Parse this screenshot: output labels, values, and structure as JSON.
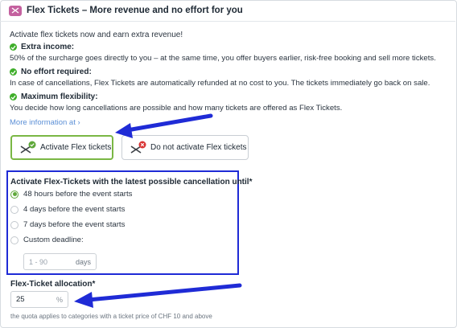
{
  "header": {
    "title": "Flex Tickets – More revenue and no effort for you",
    "logo_icon": "flex-ticket-logo-icon"
  },
  "intro": "Activate flex tickets now and earn extra revenue!",
  "features": [
    {
      "title": "Extra income:",
      "desc": "50% of the surcharge goes directly to you – at the same time, you offer buyers earlier, risk-free booking and sell more tickets."
    },
    {
      "title": "No effort required:",
      "desc": "In case of cancellations, Flex Tickets are automatically refunded at no cost to you. The tickets immediately go back on sale."
    },
    {
      "title": "Maximum flexibility:",
      "desc": "You decide how long cancellations are possible and how many tickets are offered as Flex Tickets."
    }
  ],
  "more_info": "More information at ›",
  "buttons": {
    "activate": "Activate Flex tickets",
    "deactivate": "Do not activate Flex tickets"
  },
  "cancellation": {
    "label": "Activate Flex-Tickets with the latest possible cancellation until*",
    "options": [
      "48 hours before the event starts",
      "4 days before the event starts",
      "7 days before the event starts",
      "Custom deadline:"
    ],
    "selected_index": 0,
    "custom_placeholder": "1 - 90",
    "custom_unit": "days"
  },
  "allocation": {
    "label": "Flex-Ticket allocation*",
    "value": "25",
    "unit": "%",
    "note": "the quota applies to categories with a ticket price of CHF 10 and above"
  },
  "colors": {
    "accent_green": "#5fa83a",
    "annotation_blue": "#1f2bd6",
    "brand_pink": "#c4619f",
    "link_blue": "#5b8fd6"
  }
}
